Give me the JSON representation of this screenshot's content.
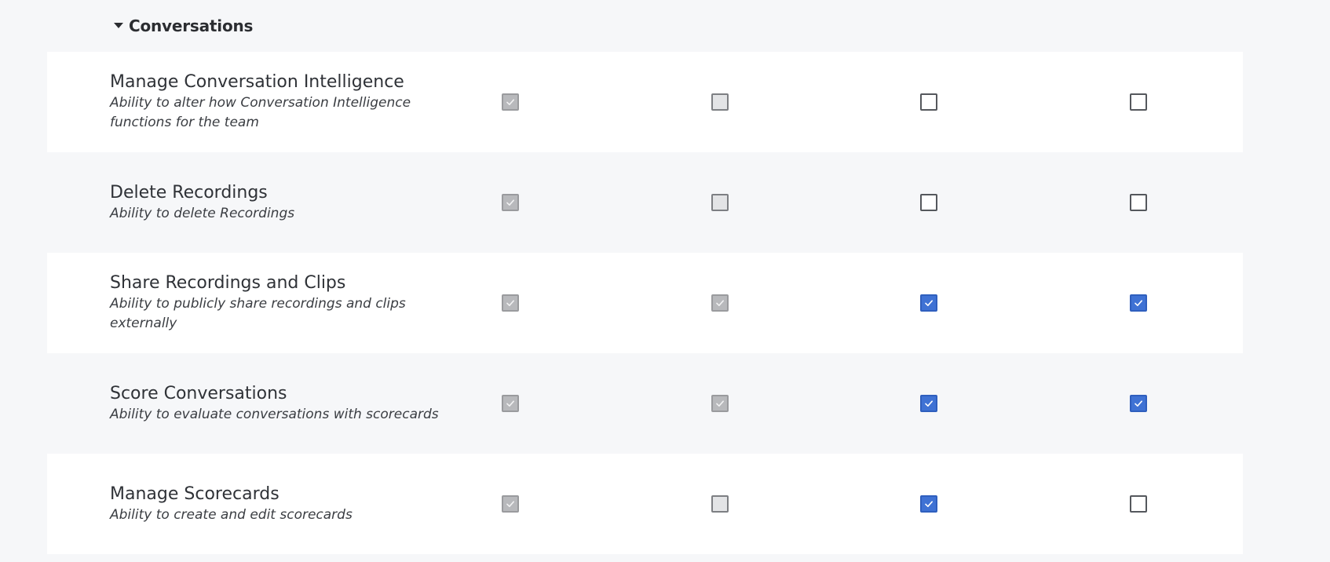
{
  "section": {
    "title": "Conversations",
    "expanded": true
  },
  "colors": {
    "checked_accent": "#3f72d4",
    "disabled_gray": "#b8b9bc",
    "row_alt_bg": "#f6f7f9"
  },
  "permissions": [
    {
      "title": "Manage Conversation Intelligence",
      "description": "Ability to alter how Conversation Intelligence functions for the team",
      "checkboxes": [
        "disabled-checked",
        "disabled-unchecked",
        "unchecked",
        "unchecked"
      ]
    },
    {
      "title": "Delete Recordings",
      "description": "Ability to delete Recordings",
      "checkboxes": [
        "disabled-checked",
        "disabled-unchecked",
        "unchecked",
        "unchecked"
      ]
    },
    {
      "title": "Share Recordings and Clips",
      "description": "Ability to publicly share recordings and clips externally",
      "checkboxes": [
        "disabled-checked",
        "disabled-checked",
        "checked",
        "checked"
      ]
    },
    {
      "title": "Score Conversations",
      "description": "Ability to evaluate conversations with scorecards",
      "checkboxes": [
        "disabled-checked",
        "disabled-checked",
        "checked",
        "checked"
      ]
    },
    {
      "title": "Manage Scorecards",
      "description": "Ability to create and edit scorecards",
      "checkboxes": [
        "disabled-checked",
        "disabled-unchecked",
        "checked",
        "unchecked"
      ]
    }
  ]
}
